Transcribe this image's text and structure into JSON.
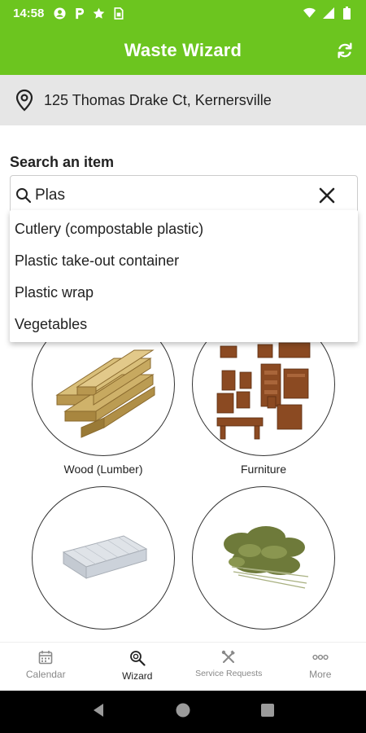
{
  "status_bar": {
    "time": "14:58",
    "icons": [
      "account-circle-icon",
      "parking-icon",
      "star-icon",
      "sim-card-icon"
    ],
    "right_icons": [
      "wifi-icon",
      "signal-icon",
      "battery-icon"
    ]
  },
  "app_bar": {
    "title": "Waste Wizard",
    "action_icon": "refresh-icon"
  },
  "address": {
    "icon": "location-pin-icon",
    "text": "125 Thomas Drake Ct, Kernersville"
  },
  "search": {
    "label": "Search an item",
    "value": "Plas",
    "icon": "search-icon",
    "clear_icon": "close-icon",
    "suggestions": [
      "Cutlery (compostable plastic)",
      "Plastic take-out container",
      "Plastic wrap",
      "Vegetables"
    ]
  },
  "categories": [
    {
      "label": "Wood (Lumber)",
      "image": "lumber-image"
    },
    {
      "label": "Furniture",
      "image": "furniture-image"
    },
    {
      "label": "",
      "image": "mattress-image"
    },
    {
      "label": "",
      "image": "yard-waste-image"
    }
  ],
  "bottom_nav": [
    {
      "label": "Calendar",
      "icon": "calendar-icon",
      "active": false
    },
    {
      "label": "Wizard",
      "icon": "wizard-search-icon",
      "active": true
    },
    {
      "label": "Service Requests",
      "icon": "tools-icon",
      "active": false
    },
    {
      "label": "More",
      "icon": "more-dots-icon",
      "active": false
    }
  ],
  "colors": {
    "brand_green": "#6cc51f",
    "address_bg": "#e6e6e6"
  }
}
